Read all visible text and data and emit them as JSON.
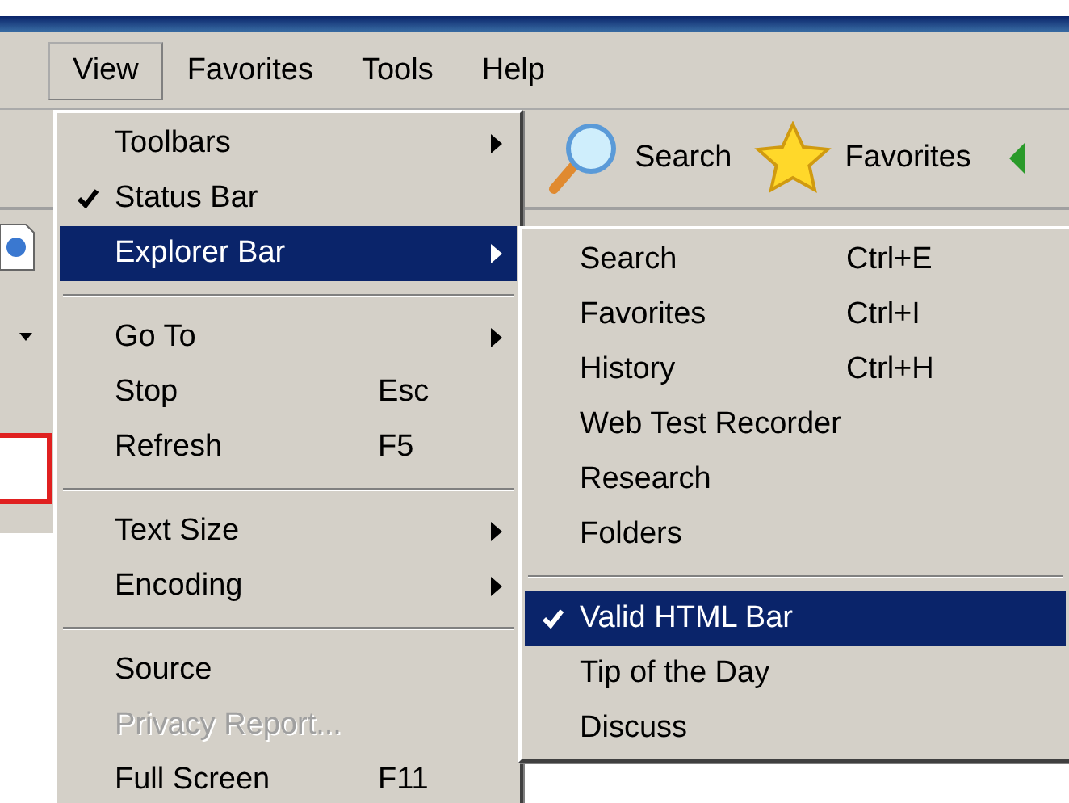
{
  "menu_bar": [
    {
      "label": "View",
      "selected": true
    },
    {
      "label": "Favorites",
      "selected": false
    },
    {
      "label": "Tools",
      "selected": false
    },
    {
      "label": "Help",
      "selected": false
    }
  ],
  "toolbar": {
    "buttons": [
      {
        "label": "Search",
        "kind": "search"
      },
      {
        "label": "Favorites",
        "kind": "favorites"
      }
    ]
  },
  "view_menu": [
    {
      "kind": "item",
      "label": "Toolbars",
      "checked": false,
      "submenu": true,
      "selected": false,
      "disabled": false
    },
    {
      "kind": "item",
      "label": "Status Bar",
      "checked": true,
      "submenu": false,
      "selected": false,
      "disabled": false
    },
    {
      "kind": "item",
      "label": "Explorer Bar",
      "checked": false,
      "submenu": true,
      "selected": true,
      "disabled": false
    },
    {
      "kind": "separator"
    },
    {
      "kind": "item",
      "label": "Go To",
      "checked": false,
      "submenu": true,
      "selected": false,
      "disabled": false
    },
    {
      "kind": "item",
      "label": "Stop",
      "shortcut": "Esc",
      "checked": false,
      "submenu": false,
      "selected": false,
      "disabled": false
    },
    {
      "kind": "item",
      "label": "Refresh",
      "shortcut": "F5",
      "checked": false,
      "submenu": false,
      "selected": false,
      "disabled": false
    },
    {
      "kind": "separator"
    },
    {
      "kind": "item",
      "label": "Text Size",
      "checked": false,
      "submenu": true,
      "selected": false,
      "disabled": false
    },
    {
      "kind": "item",
      "label": "Encoding",
      "checked": false,
      "submenu": true,
      "selected": false,
      "disabled": false
    },
    {
      "kind": "separator"
    },
    {
      "kind": "item",
      "label": "Source",
      "checked": false,
      "submenu": false,
      "selected": false,
      "disabled": false
    },
    {
      "kind": "item",
      "label": "Privacy Report...",
      "checked": false,
      "submenu": false,
      "selected": false,
      "disabled": true
    },
    {
      "kind": "item",
      "label": "Full Screen",
      "shortcut": "F11",
      "checked": false,
      "submenu": false,
      "selected": false,
      "disabled": false
    }
  ],
  "explorer_bar_menu": [
    {
      "kind": "item",
      "label": "Search",
      "shortcut": "Ctrl+E",
      "checked": false,
      "submenu": false,
      "selected": false,
      "disabled": false
    },
    {
      "kind": "item",
      "label": "Favorites",
      "shortcut": "Ctrl+I",
      "checked": false,
      "submenu": false,
      "selected": false,
      "disabled": false
    },
    {
      "kind": "item",
      "label": "History",
      "shortcut": "Ctrl+H",
      "checked": false,
      "submenu": false,
      "selected": false,
      "disabled": false
    },
    {
      "kind": "item",
      "label": "Web Test Recorder",
      "checked": false,
      "submenu": false,
      "selected": false,
      "disabled": false
    },
    {
      "kind": "item",
      "label": "Research",
      "checked": false,
      "submenu": false,
      "selected": false,
      "disabled": false
    },
    {
      "kind": "item",
      "label": "Folders",
      "checked": false,
      "submenu": false,
      "selected": false,
      "disabled": false
    },
    {
      "kind": "separator"
    },
    {
      "kind": "item",
      "label": "Valid HTML Bar",
      "checked": true,
      "submenu": false,
      "selected": true,
      "disabled": false
    },
    {
      "kind": "item",
      "label": "Tip of the Day",
      "checked": false,
      "submenu": false,
      "selected": false,
      "disabled": false
    },
    {
      "kind": "item",
      "label": "Discuss",
      "checked": false,
      "submenu": false,
      "selected": false,
      "disabled": false
    }
  ]
}
